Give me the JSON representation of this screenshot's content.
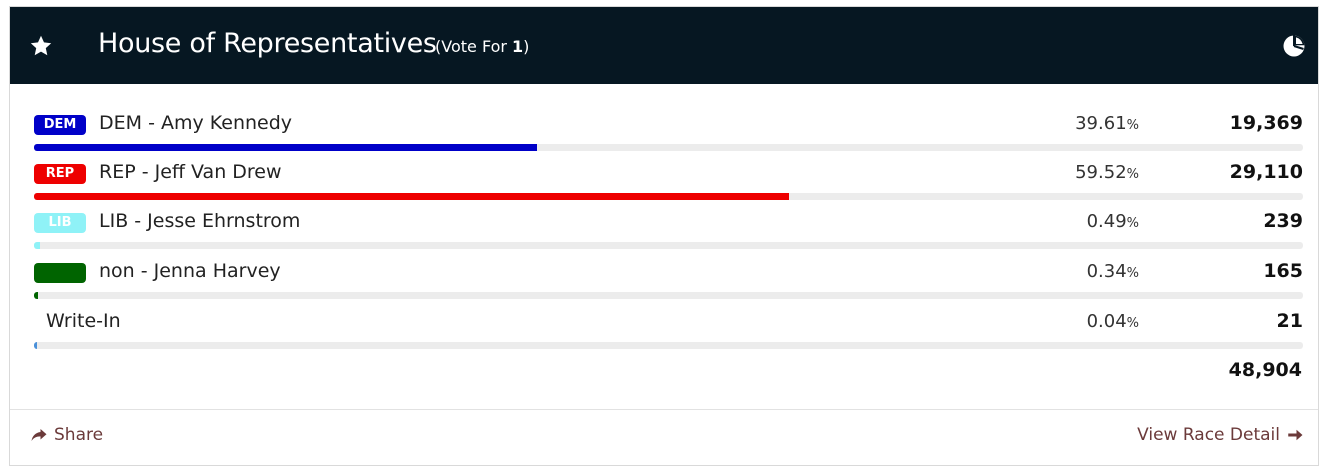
{
  "header": {
    "title": "House of Representatives",
    "vote_for_prefix": "(Vote For ",
    "vote_for_count": "1",
    "vote_for_suffix": ")",
    "background": "#061722",
    "left_icon": "star-icon",
    "right_icon": "pie-chart-icon"
  },
  "candidates": [
    {
      "badge": "DEM",
      "badge_color": "#0000c8",
      "name": "DEM - Amy Kennedy",
      "percent": "39.61",
      "percent_sign": "%",
      "votes": "19,369",
      "bar_fraction": 0.3961,
      "bar_color": "#0000c8"
    },
    {
      "badge": "REP",
      "badge_color": "#ee0000",
      "name": "REP - Jeff Van Drew",
      "percent": "59.52",
      "percent_sign": "%",
      "votes": "29,110",
      "bar_fraction": 0.5952,
      "bar_color": "#ee0000"
    },
    {
      "badge": "LIB",
      "badge_color": "#8ff2f7",
      "name": "LIB - Jesse Ehrnstrom",
      "percent": "0.49",
      "percent_sign": "%",
      "votes": "239",
      "bar_fraction": 0.0049,
      "bar_color": "#8ff2f7"
    },
    {
      "badge": "",
      "badge_color": "#006400",
      "name": "non - Jenna Harvey",
      "percent": "0.34",
      "percent_sign": "%",
      "votes": "165",
      "bar_fraction": 0.0034,
      "bar_color": "#006400"
    },
    {
      "badge": null,
      "badge_color": null,
      "name": "Write-In",
      "percent": "0.04",
      "percent_sign": "%",
      "votes": "21",
      "bar_fraction": 0.0004,
      "bar_color": "#4a90d9"
    }
  ],
  "total_votes": "48,904",
  "footer": {
    "share_label": "Share",
    "share_icon": "share-arrow-icon",
    "detail_label": "View Race Detail",
    "detail_icon": "arrow-right-icon",
    "link_color": "#6b3a3a"
  }
}
